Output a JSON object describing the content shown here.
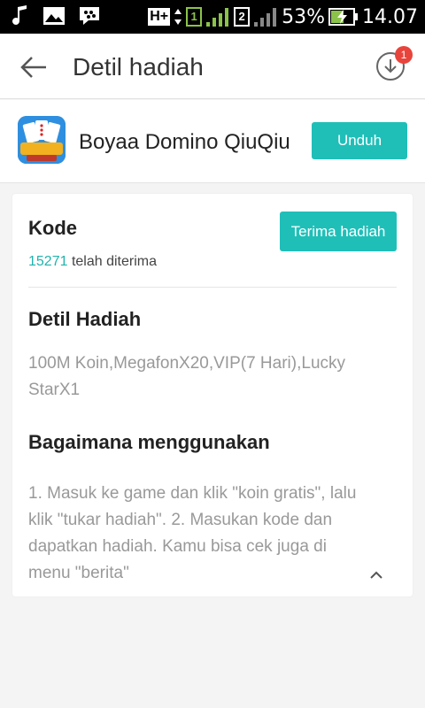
{
  "status_bar": {
    "sim1": "1",
    "sim2": "2",
    "network": "H+",
    "battery": "53%",
    "time": "14.07"
  },
  "appbar": {
    "title": "Detil hadiah",
    "download_badge": "1"
  },
  "app": {
    "name": "Boyaa Domino QiuQiu",
    "download_label": "Unduh"
  },
  "code_section": {
    "title": "Kode",
    "received_count": "15271",
    "received_suffix": " telah diterima",
    "receive_button": "Terima hadiah"
  },
  "detail_section": {
    "title": "Detil Hadiah",
    "body": "100M Koin,MegafonX20,VIP(7 Hari),Lucky StarX1"
  },
  "usage_section": {
    "title": "Bagaimana menggunakan",
    "body": "1. Masuk ke game dan klik \"koin gratis\", lalu klik \"tukar hadiah\". 2. Masukan kode dan dapatkan hadiah. Kamu bisa cek juga di menu \"berita\""
  },
  "colors": {
    "accent": "#1fbfb8",
    "badge": "#e8443b"
  }
}
